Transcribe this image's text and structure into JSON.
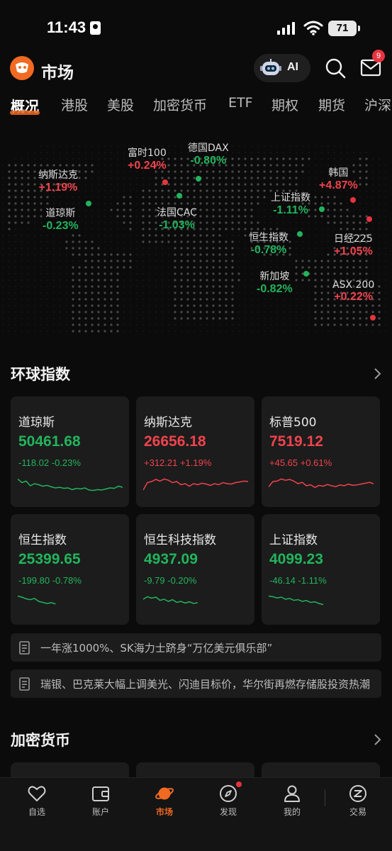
{
  "status_bar": {
    "time": "11:43",
    "battery": "71"
  },
  "header": {
    "title": "市场",
    "ai_label": "AI",
    "mail_badge": "9"
  },
  "tabs": [
    "概况",
    "港股",
    "美股",
    "加密货币",
    "ETF",
    "期权",
    "期货",
    "沪深"
  ],
  "world_markets": [
    {
      "name": "纳斯达克",
      "change": "+1.19%",
      "direction": "up"
    },
    {
      "name": "道琼斯",
      "change": "-0.23%",
      "direction": "down"
    },
    {
      "name": "富时100",
      "change": "+0.24%",
      "direction": "up"
    },
    {
      "name": "德国DAX",
      "change": "-0.80%",
      "direction": "down"
    },
    {
      "name": "法国CAC",
      "change": "-1.03%",
      "direction": "down"
    },
    {
      "name": "韩国",
      "change": "+4.87%",
      "direction": "up"
    },
    {
      "name": "上证指数",
      "change": "-1.11%",
      "direction": "down"
    },
    {
      "name": "恒生指数",
      "change": "-0.78%",
      "direction": "down"
    },
    {
      "name": "日经225",
      "change": "+1.05%",
      "direction": "up"
    },
    {
      "name": "新加坡",
      "change": "-0.82%",
      "direction": "down"
    },
    {
      "name": "ASX 200",
      "change": "+0.22%",
      "direction": "up"
    }
  ],
  "global_indices": {
    "title": "环球指数",
    "cards": [
      {
        "name": "道琼斯",
        "price": "50461.68",
        "change": "-118.02 -0.23%",
        "direction": "down",
        "spark": [
          0.72,
          0.55,
          0.62,
          0.4,
          0.5,
          0.45,
          0.38,
          0.42,
          0.35,
          0.3,
          0.33,
          0.28,
          0.3,
          0.22,
          0.28,
          0.25,
          0.3,
          0.2,
          0.18,
          0.22,
          0.2,
          0.25,
          0.3,
          0.28,
          0.38,
          0.33
        ]
      },
      {
        "name": "纳斯达克",
        "price": "26656.18",
        "change": "+312.21 +1.19%",
        "direction": "up",
        "spark": [
          0.2,
          0.55,
          0.6,
          0.7,
          0.62,
          0.72,
          0.66,
          0.55,
          0.6,
          0.45,
          0.5,
          0.38,
          0.5,
          0.45,
          0.52,
          0.48,
          0.42,
          0.5,
          0.45,
          0.55,
          0.5,
          0.48,
          0.55,
          0.58,
          0.62,
          0.6
        ]
      },
      {
        "name": "标普500",
        "price": "7519.12",
        "change": "+45.65 +0.61%",
        "direction": "up",
        "spark": [
          0.35,
          0.6,
          0.62,
          0.72,
          0.66,
          0.7,
          0.62,
          0.5,
          0.56,
          0.4,
          0.45,
          0.32,
          0.42,
          0.38,
          0.46,
          0.4,
          0.36,
          0.44,
          0.4,
          0.48,
          0.42,
          0.44,
          0.48,
          0.52,
          0.56,
          0.5
        ]
      },
      {
        "name": "恒生指数",
        "price": "25399.65",
        "change": "-199.80 -0.78%",
        "direction": "down",
        "spark": [
          0.75,
          0.7,
          0.62,
          0.58,
          0.64,
          0.5,
          0.45,
          0.4,
          0.44,
          0.38
        ]
      },
      {
        "name": "恒生科技指数",
        "price": "4937.09",
        "change": "-9.79 -0.20%",
        "direction": "down",
        "spark": [
          0.6,
          0.72,
          0.65,
          0.7,
          0.55,
          0.6,
          0.5,
          0.58,
          0.45,
          0.5,
          0.42,
          0.48,
          0.4,
          0.44
        ]
      },
      {
        "name": "上证指数",
        "price": "4099.23",
        "change": "-46.14 -1.11%",
        "direction": "down",
        "spark": [
          0.75,
          0.72,
          0.66,
          0.7,
          0.6,
          0.64,
          0.55,
          0.58,
          0.5,
          0.54,
          0.45,
          0.48,
          0.4,
          0.35
        ]
      }
    ]
  },
  "news": [
    "一年涨1000%、SK海力士跻身“万亿美元俱乐部”",
    "瑞银、巴克莱大幅上调美光、闪迪目标价，华尔街再燃存储股投资热潮"
  ],
  "crypto": {
    "title": "加密货币"
  },
  "bottom_nav": [
    {
      "label": "自选",
      "icon": "heart-icon"
    },
    {
      "label": "账户",
      "icon": "wallet-icon"
    },
    {
      "label": "市场",
      "icon": "planet-icon",
      "active": true
    },
    {
      "label": "发现",
      "icon": "compass-icon"
    },
    {
      "label": "我的",
      "icon": "person-icon"
    },
    {
      "label": "交易",
      "icon": "trade-icon"
    }
  ],
  "colors": {
    "accent": "#f06a22",
    "up": "#f0434d",
    "down": "#22b45c",
    "background": "#0b0b0b",
    "card": "#1c1c1c"
  }
}
